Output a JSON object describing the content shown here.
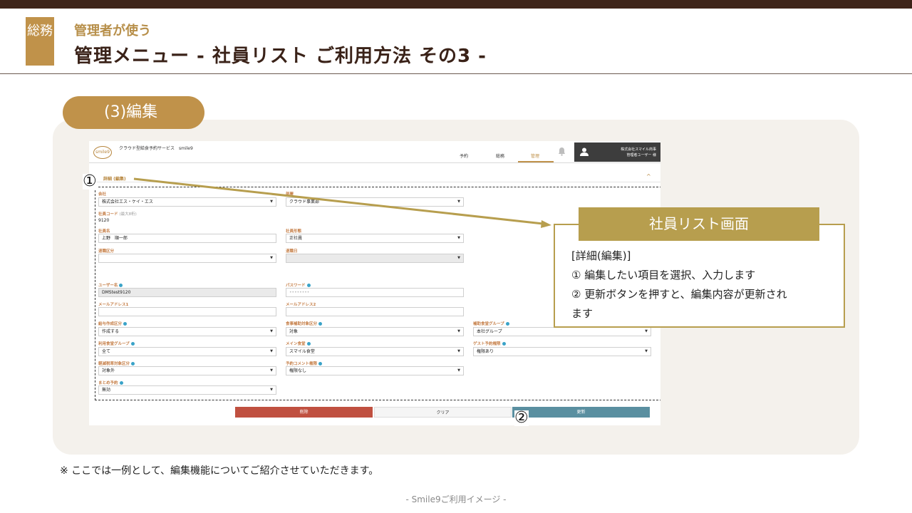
{
  "header": {
    "category": "総務",
    "subtitle": "管理者が使う",
    "title": "管理メニュー - 社員リスト ご利用方法 その3 -"
  },
  "section": {
    "label": "(3)編集"
  },
  "app": {
    "logo_text": "smile9",
    "service_name": "クラウド型給食予約サービス　smile9",
    "nav": [
      "予約",
      "総務",
      "管理"
    ],
    "active_nav": "管理",
    "user": {
      "company": "株式会社スマイル商事",
      "name": "管理者ユーザー 様"
    },
    "detail_heading": "詳細 (編集)",
    "fields": {
      "company": {
        "label": "会社",
        "value": "株式会社エス・ケイ・エス"
      },
      "department": {
        "label": "部署",
        "value": "クラウド事業部"
      },
      "employee_code": {
        "label": "社員コード",
        "hint": "(最大8桁)",
        "value": "9120"
      },
      "employee_name": {
        "label": "社員名",
        "value": "上野　順一郎"
      },
      "employment_type": {
        "label": "社員形態",
        "value": "正社員"
      },
      "retire_type": {
        "label": "退職区分",
        "value": ""
      },
      "retire_date": {
        "label": "退職日",
        "value": ""
      },
      "username": {
        "label": "ユーザー名",
        "value": "DMStest9120"
      },
      "password": {
        "label": "パスワード",
        "value": "••••••••"
      },
      "email1": {
        "label": "メールアドレス1",
        "value": ""
      },
      "email2": {
        "label": "メールアドレス2",
        "value": ""
      },
      "salary_type": {
        "label": "給与作成区分",
        "value": "作成する"
      },
      "meal_subsidy": {
        "label": "食事補助対象区分",
        "value": "対象"
      },
      "subsidy_group": {
        "label": "補助食堂グループ",
        "value": "本社グループ"
      },
      "cafeteria_group": {
        "label": "利用食堂グループ",
        "value": "全て"
      },
      "main_cafeteria": {
        "label": "メイン食堂",
        "value": "スマイル食堂"
      },
      "guest_permission": {
        "label": "ゲスト予約権限",
        "value": "権限あり"
      },
      "reduced_tax": {
        "label": "軽減税率対象区分",
        "value": "対象外"
      },
      "comment_permission": {
        "label": "予約コメント権限",
        "value": "権限なし"
      },
      "bulk_reserve": {
        "label": "まとめ予約",
        "value": "無効"
      }
    },
    "buttons": {
      "delete": "削除",
      "clear": "クリア",
      "update": "更新"
    }
  },
  "markers": {
    "one": "①",
    "two": "②"
  },
  "callout": {
    "title": "社員リスト画面",
    "lines": [
      "[詳細(編集)]",
      "① 編集したい項目を選択、入力します",
      "② 更新ボタンを押すと、編集内容が更新され",
      "ます"
    ]
  },
  "note": "※ ここでは一例として、編集機能についてご紹介させていただきます。",
  "footer": "- Smile9ご利用イメージ -",
  "colors": {
    "brown_dark": "#3e2419",
    "gold": "#c0924a",
    "olive_gold": "#b79e4e",
    "delete_red": "#c05040",
    "update_teal": "#5a8fa0"
  }
}
